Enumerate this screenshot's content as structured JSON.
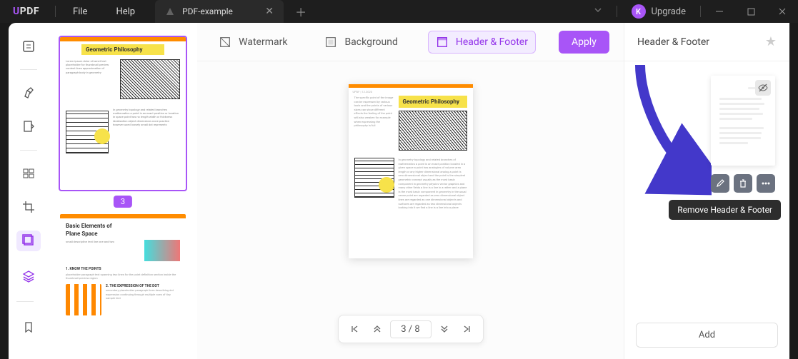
{
  "app": {
    "logo_prefix": "U",
    "logo_suffix": "PDF"
  },
  "menu": {
    "file": "File",
    "help": "Help"
  },
  "tab": {
    "title": "PDF-example"
  },
  "titlebar": {
    "upgrade": "Upgrade",
    "avatar_initial": "K"
  },
  "tools": {
    "watermark": "Watermark",
    "background": "Background",
    "header_footer": "Header & Footer",
    "apply": "Apply"
  },
  "thumbs": {
    "current_badge": "3",
    "page3_title": "Geometric Philosophy",
    "page4_title1": "Basic Elements of",
    "page4_title2": "Plane Space",
    "page4_sec1": "1. KNOW THE POINTS",
    "page4_sec2": "2. THE EXPRESSION OF THE DOT"
  },
  "page": {
    "title": "Geometric Philosophy"
  },
  "pager": {
    "display": "3  /  8"
  },
  "right_panel": {
    "title": "Header & Footer",
    "tooltip": "Remove Header & Footer",
    "add": "Add"
  }
}
